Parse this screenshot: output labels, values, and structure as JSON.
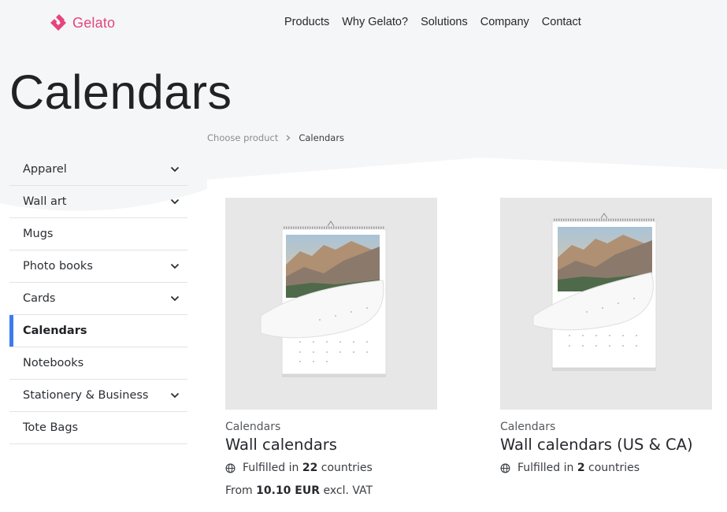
{
  "brand": {
    "name": "Gelato",
    "color": "#e5457f"
  },
  "nav": {
    "items": [
      "Products",
      "Why Gelato?",
      "Solutions",
      "Company",
      "Contact"
    ]
  },
  "page": {
    "title": "Calendars"
  },
  "breadcrumb": {
    "items": [
      {
        "label": "Choose product",
        "link": true
      },
      {
        "label": "Calendars",
        "link": false
      }
    ],
    "separator_icon": "chevron-right-icon"
  },
  "sidebar": {
    "accent_color": "#3b7cf0",
    "items": [
      {
        "label": "Apparel",
        "expandable": true,
        "active": false
      },
      {
        "label": "Wall art",
        "expandable": true,
        "active": false
      },
      {
        "label": "Mugs",
        "expandable": false,
        "active": false
      },
      {
        "label": "Photo books",
        "expandable": true,
        "active": false
      },
      {
        "label": "Cards",
        "expandable": true,
        "active": false
      },
      {
        "label": "Calendars",
        "expandable": false,
        "active": true
      },
      {
        "label": "Notebooks",
        "expandable": false,
        "active": false
      },
      {
        "label": "Stationery & Business",
        "expandable": true,
        "active": false
      },
      {
        "label": "Tote Bags",
        "expandable": false,
        "active": false
      }
    ]
  },
  "products": [
    {
      "category": "Calendars",
      "title": "Wall calendars",
      "fulfilled_prefix": "Fulfilled in",
      "countries": "22",
      "fulfilled_suffix": "countries",
      "price_prefix": "From",
      "price": "10.10 EUR",
      "price_suffix": "excl. VAT",
      "image": "wall-calendar-mountain-photo"
    },
    {
      "category": "Calendars",
      "title": "Wall calendars (US & CA)",
      "fulfilled_prefix": "Fulfilled in",
      "countries": "2",
      "fulfilled_suffix": "countries",
      "image": "wall-calendar-mountain-photo"
    }
  ]
}
